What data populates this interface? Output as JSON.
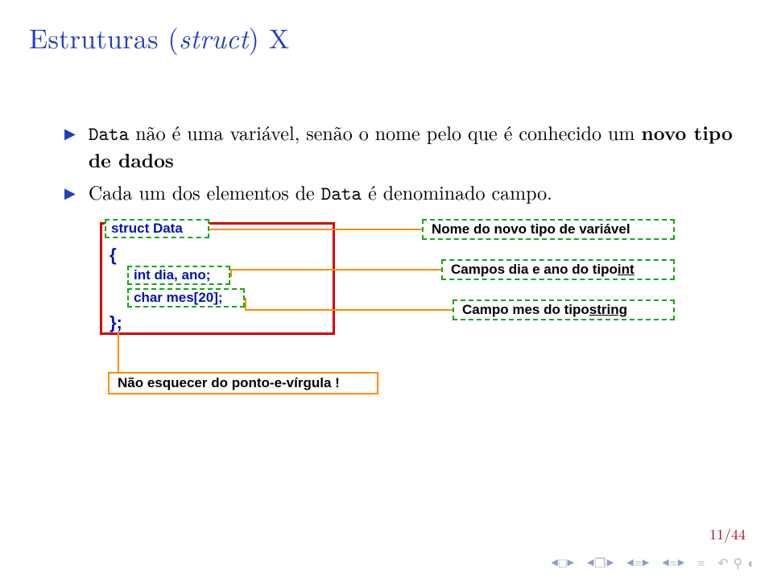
{
  "title": {
    "prefix": "Estruturas (",
    "em": "struct",
    "suffix": ") X"
  },
  "bullets": {
    "b1": {
      "pre": "Data",
      "mid": " não é uma variável, senão o nome pelo que é conhecido um ",
      "bold": "novo tipo de dados"
    },
    "b2": {
      "pre": "Cada um dos elementos de ",
      "code": "Data",
      "post": " é denominado campo."
    }
  },
  "code": {
    "line1": "struct Data",
    "brace_open": "{",
    "line2": "int dia, ano;",
    "line3": "char mes[20];",
    "brace_close": "};"
  },
  "labels": {
    "l1": "Nome do novo tipo de variável",
    "l2_a": "Campos dia e ano do tipo ",
    "l2_b": "int",
    "l3_a": "Campo mes do tipo ",
    "l3_b": "string",
    "warn": "Não esquecer do ponto-e-vírgula !"
  },
  "page": "11/44"
}
